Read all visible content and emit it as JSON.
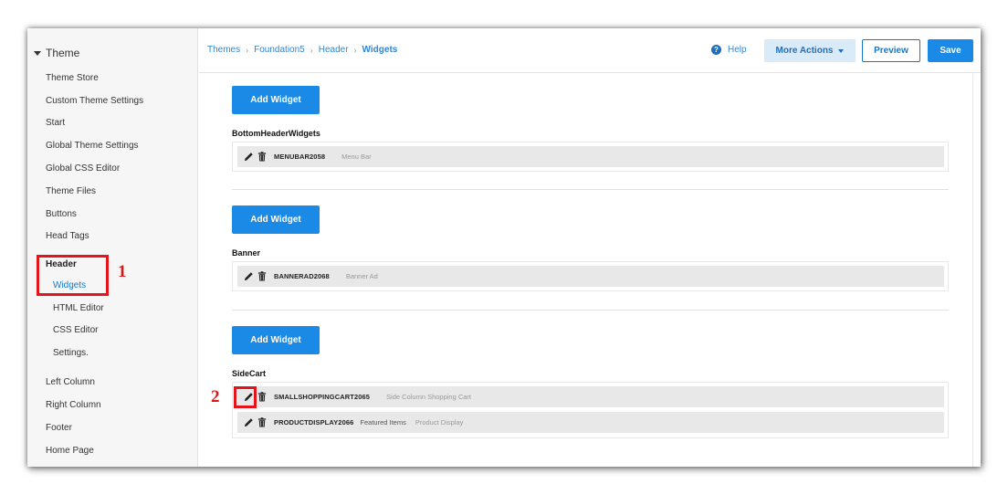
{
  "sidebar": {
    "title": "Theme",
    "items": [
      {
        "label": "Theme Store"
      },
      {
        "label": "Custom Theme Settings"
      },
      {
        "label": "Start"
      },
      {
        "label": "Global Theme Settings"
      },
      {
        "label": "Global CSS Editor"
      },
      {
        "label": "Theme Files"
      },
      {
        "label": "Buttons"
      },
      {
        "label": "Head Tags"
      },
      {
        "label": "Header"
      },
      {
        "label": "Widgets"
      },
      {
        "label": "HTML Editor"
      },
      {
        "label": "CSS Editor"
      },
      {
        "label": "Settings."
      },
      {
        "label": "Left Column"
      },
      {
        "label": "Right Column"
      },
      {
        "label": "Footer"
      },
      {
        "label": "Home Page"
      }
    ]
  },
  "breadcrumb": {
    "items": [
      "Themes",
      "Foundation5",
      "Header",
      "Widgets"
    ],
    "separator": "›"
  },
  "toolbar": {
    "help_label": "Help",
    "help_icon": "?",
    "more_actions_label": "More Actions",
    "preview_label": "Preview",
    "save_label": "Save"
  },
  "sections": [
    {
      "add_label": "Add Widget",
      "title": "BottomHeaderWidgets",
      "widgets": [
        {
          "code": "MENUBAR2058",
          "description": "Menu Bar"
        }
      ]
    },
    {
      "add_label": "Add Widget",
      "title": "Banner",
      "widgets": [
        {
          "code": "BANNERAD2068",
          "description": "Banner Ad"
        }
      ]
    },
    {
      "add_label": "Add Widget",
      "title": "SideCart",
      "widgets": [
        {
          "code": "SMALLSHOPPINGCART2065",
          "description": "Side Column Shopping Cart"
        },
        {
          "code": "PRODUCTDISPLAY2066",
          "featured": "Featured Items",
          "description": "Product Display"
        }
      ]
    }
  ],
  "annotations": {
    "marker_1": "1",
    "marker_2": "2",
    "color": "#e2151b"
  },
  "colors": {
    "primary": "#1a8ae6",
    "link": "#2e86d4",
    "more_actions_bg": "#d9eaf8"
  }
}
